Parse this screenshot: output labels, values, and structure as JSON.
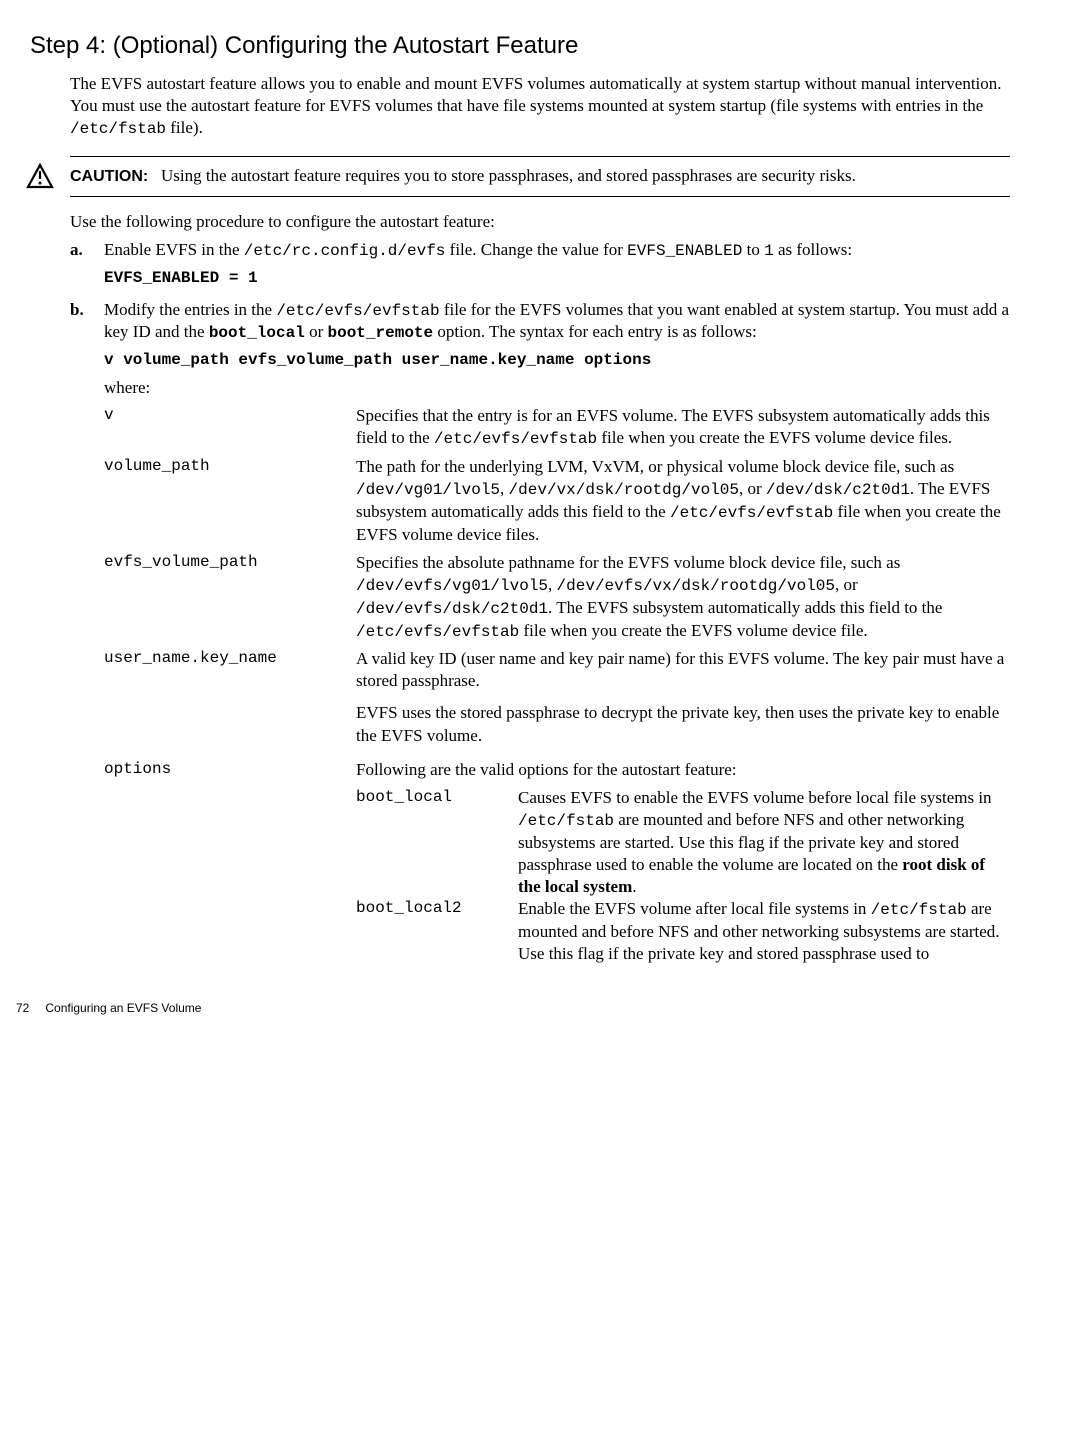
{
  "heading": "Step 4: (Optional) Configuring the Autostart Feature",
  "intro_p1": "The EVFS autostart feature allows you to enable and mount EVFS volumes automatically at system startup without manual intervention. You must use the autostart feature for EVFS volumes that have file systems mounted at system startup (file systems with entries in the ",
  "intro_code": "/etc/fstab",
  "intro_p1_end": " file).",
  "caution_label": "CAUTION:",
  "caution_text": "Using the autostart feature requires you to store passphrases, and stored passphrases are security risks.",
  "use_following": "Use the following procedure to configure the autostart feature:",
  "step_a": {
    "letter": "a.",
    "t1": "Enable EVFS in the ",
    "c1": "/etc/rc.config.d/evfs",
    "t2": " file. Change the value for ",
    "c2": "EVFS_ENABLED",
    "t3": " to ",
    "c3": "1",
    "t4": " as follows:",
    "codeblock": "EVFS_ENABLED = 1"
  },
  "step_b": {
    "letter": "b.",
    "t1": "Modify the entries in the ",
    "c1": "/etc/evfs/evfstab",
    "t2": " file for the EVFS volumes that you want enabled at system startup. You must add a key ID and the ",
    "bc1": "boot_local",
    "t3": " or ",
    "bc2": "boot_remote",
    "t4": " option. The syntax for each entry is as follows:",
    "syntax": "v volume_path evfs_volume_path user_name.key_name options",
    "where": "where:"
  },
  "terms": {
    "v": {
      "term": "v",
      "t1": "Specifies that the entry is for an EVFS volume. The EVFS subsystem automatically adds this field to the ",
      "c1": "/etc/evfs/evfstab",
      "t2": " file when you create the EVFS volume device files."
    },
    "volume_path": {
      "term": "volume_path",
      "t1": "The path for the underlying LVM, VxVM, or physical volume block device file, such as ",
      "c1": "/dev/vg01/lvol5",
      "t2": ", ",
      "c2": "/dev/vx/dsk/rootdg/vol05",
      "t3": ", or ",
      "c3": "/dev/dsk/c2t0d1",
      "t4": ". The EVFS subsystem automatically adds this field to the ",
      "c4": "/etc/evfs/evfstab",
      "t5": " file when you create the EVFS volume device files."
    },
    "evfs_volume_path": {
      "term": "evfs_volume_path",
      "t1": "Specifies the absolute pathname for the EVFS volume block device file, such as ",
      "c1": "/dev/evfs/vg01/lvol5",
      "t2": ", ",
      "c2": "/dev/evfs/vx/dsk/rootdg/vol05",
      "t3": ", or ",
      "c3": "/dev/evfs/dsk/c2t0d1",
      "t4": ". The EVFS subsystem automatically adds this field to the ",
      "c4": "/etc/evfs/evfstab",
      "t5": " file when you create the EVFS volume device file."
    },
    "user_name_key_name": {
      "term": "user_name.key_name",
      "t1": "A valid key ID (user name and key pair name) for this EVFS volume. The key pair must have a stored passphrase.",
      "t2": "EVFS uses the stored passphrase to decrypt the private key, then uses the private key to enable the EVFS volume."
    },
    "options": {
      "term": "options",
      "t1": "Following are the valid options for the autostart feature:",
      "boot_local": {
        "term": "boot_local",
        "t1": "Causes EVFS to enable the EVFS volume before local file systems in ",
        "c1": "/etc/fstab",
        "t2": " are mounted and before NFS and other networking subsystems are started. Use this flag if the private key and stored passphrase used to enable the volume are located on the ",
        "bold": "root disk of the local system",
        "t3": "."
      },
      "boot_local2": {
        "term": "boot_local2",
        "t1": "Enable the EVFS volume after local file systems in ",
        "c1": "/etc/fstab",
        "t2": " are mounted and before NFS and other networking subsystems are started. Use this flag if the private key and stored passphrase used to"
      }
    }
  },
  "footer": {
    "page": "72",
    "title": "Configuring an EVFS Volume"
  }
}
